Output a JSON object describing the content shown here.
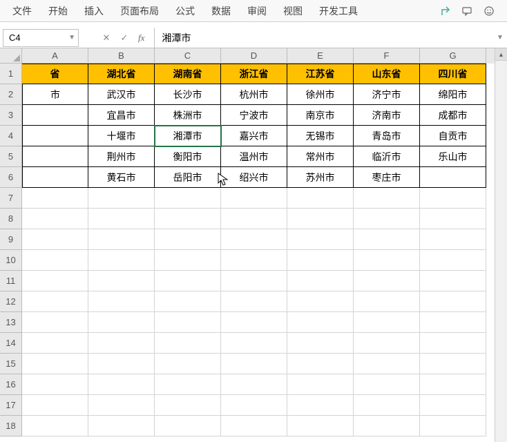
{
  "menu": {
    "items": [
      "文件",
      "开始",
      "插入",
      "页面布局",
      "公式",
      "数据",
      "审阅",
      "视图",
      "开发工具"
    ]
  },
  "nameBox": {
    "value": "C4"
  },
  "formulaBar": {
    "value": "湘潭市"
  },
  "columns": [
    "A",
    "B",
    "C",
    "D",
    "E",
    "F",
    "G"
  ],
  "rowCount": 18,
  "selectedCell": {
    "row": 4,
    "col": 2
  },
  "data": {
    "headers": [
      "省",
      "湖北省",
      "湖南省",
      "浙江省",
      "江苏省",
      "山东省",
      "四川省"
    ],
    "rows": [
      [
        "市",
        "武汉市",
        "长沙市",
        "杭州市",
        "徐州市",
        "济宁市",
        "绵阳市"
      ],
      [
        "",
        "宜昌市",
        "株洲市",
        "宁波市",
        "南京市",
        "济南市",
        "成都市"
      ],
      [
        "",
        "十堰市",
        "湘潭市",
        "嘉兴市",
        "无锡市",
        "青岛市",
        "自贡市"
      ],
      [
        "",
        "荆州市",
        "衡阳市",
        "温州市",
        "常州市",
        "临沂市",
        "乐山市"
      ],
      [
        "",
        "黄石市",
        "岳阳市",
        "绍兴市",
        "苏州市",
        "枣庄市",
        ""
      ]
    ]
  }
}
